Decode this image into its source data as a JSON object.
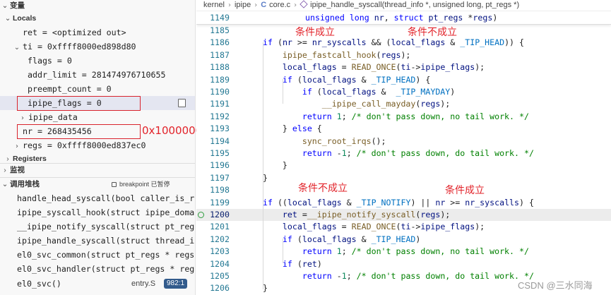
{
  "vars_title": "变量",
  "locals_title": "Locals",
  "vars": [
    "ret = <optimized out>",
    "ti = 0xffff8000ed898d80",
    "flags = 0",
    "addr_limit = 281474976710655",
    "preempt_count = 0",
    "ipipe_flags = 0",
    "ipipe_data",
    "nr = 268435456",
    "regs = 0xffff8000ed837ec0"
  ],
  "registers_title": "Registers",
  "watch_title": "监视",
  "callstack_title": "调用堆栈",
  "callstack_status": "breakpoint 已暂停",
  "stack": [
    "handle_head_syscall(bool caller_is_relaxed",
    "ipipe_syscall_hook(struct ipipe_domain",
    "__ipipe_notify_syscall(struct pt_regs",
    "ipipe_handle_syscall(struct thread_info",
    "el0_svc_common(struct pt_regs * regs,",
    "el0_svc_handler(struct pt_regs * regs)",
    "el0_svc()"
  ],
  "stack_file": "entry.S",
  "stack_badge": "982:1",
  "nr_annotation": "0x10000000",
  "breadcrumb": {
    "parts": [
      "kernel",
      "ipipe",
      "core.c",
      "ipipe_handle_syscall(thread_info *, unsigned long, pt_regs *)"
    ],
    "c_badge": "C"
  },
  "sticky": {
    "line": "1149",
    "text": "unsigned long nr, struct pt_regs *regs)"
  },
  "code_lines": [
    {
      "n": "1185",
      "t": ""
    },
    {
      "n": "1186",
      "t": "if (nr >= nr_syscalls && (local_flags & _TIP_HEAD)) {"
    },
    {
      "n": "1187",
      "t": "    ipipe_fastcall_hook(regs);"
    },
    {
      "n": "1188",
      "t": "    local_flags = READ_ONCE(ti->ipipe_flags);"
    },
    {
      "n": "1189",
      "t": "    if (local_flags & _TIP_HEAD) {"
    },
    {
      "n": "1190",
      "t": "        if (local_flags &  _TIP_MAYDAY)"
    },
    {
      "n": "1191",
      "t": "            __ipipe_call_mayday(regs);"
    },
    {
      "n": "1192",
      "t": "        return 1; /* don't pass down, no tail work. */"
    },
    {
      "n": "1193",
      "t": "    } else {"
    },
    {
      "n": "1194",
      "t": "        sync_root_irqs();"
    },
    {
      "n": "1195",
      "t": "        return -1; /* don't pass down, do tail work. */"
    },
    {
      "n": "1196",
      "t": "    }"
    },
    {
      "n": "1197",
      "t": "}"
    },
    {
      "n": "1198",
      "t": ""
    },
    {
      "n": "1199",
      "t": "if ((local_flags & _TIP_NOTIFY) || nr >= nr_syscalls) {"
    },
    {
      "n": "1200",
      "t": "    ret =__ipipe_notify_syscall(regs);"
    },
    {
      "n": "1201",
      "t": "    local_flags = READ_ONCE(ti->ipipe_flags);"
    },
    {
      "n": "1202",
      "t": "    if (local_flags & _TIP_HEAD)"
    },
    {
      "n": "1203",
      "t": "        return 1; /* don't pass down, no tail work. */"
    },
    {
      "n": "1204",
      "t": "    if (ret)"
    },
    {
      "n": "1205",
      "t": "        return -1; /* don't pass down, do tail work. */"
    },
    {
      "n": "1206",
      "t": "}"
    }
  ],
  "annotations": {
    "cond_true_1": "条件成立",
    "cond_false_1": "条件不成立",
    "cond_false_2": "条件不成立",
    "cond_true_2": "条件成立"
  },
  "watermark": "CSDN @三水同海",
  "colors": {
    "annotation": "#e2232a",
    "keyword": "#0000ff",
    "function": "#795e26",
    "comment": "#008000",
    "number": "#098658"
  }
}
